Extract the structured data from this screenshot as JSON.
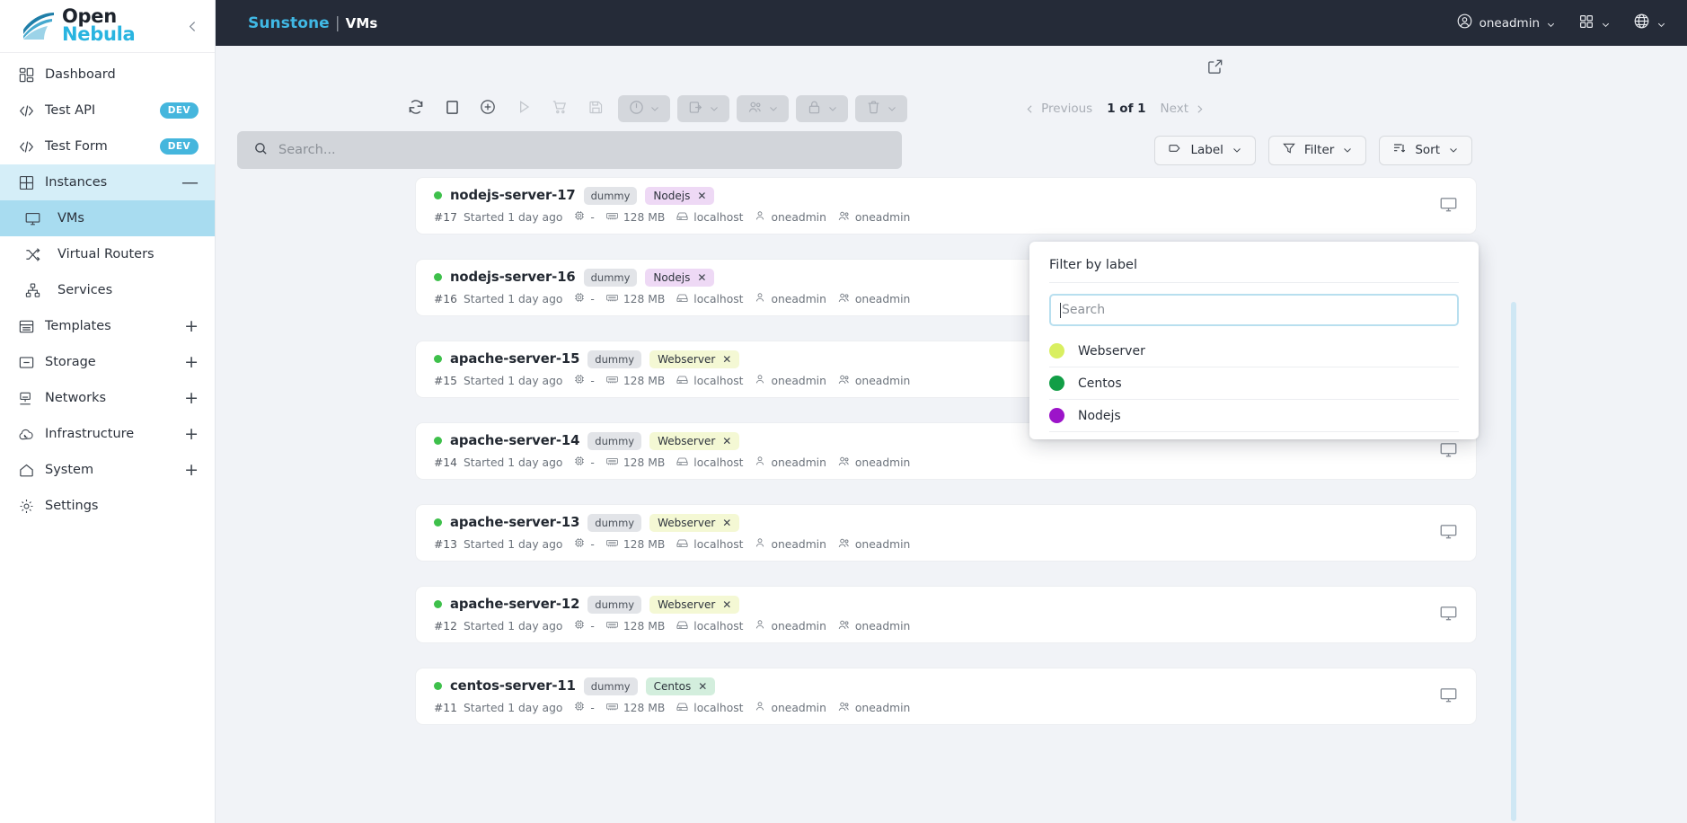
{
  "brand": {
    "line1": "Open",
    "line2": "Nebula",
    "collapse_icon": "chevron-left-icon"
  },
  "sidebar": {
    "items": [
      {
        "label": "Dashboard",
        "icon": "dashboard-icon",
        "badge": null,
        "suffix": null,
        "level": 0,
        "state": "normal"
      },
      {
        "label": "Test API",
        "icon": "code-icon",
        "badge": "DEV",
        "suffix": null,
        "level": 0,
        "state": "normal"
      },
      {
        "label": "Test Form",
        "icon": "code-icon",
        "badge": "DEV",
        "suffix": null,
        "level": 0,
        "state": "normal"
      },
      {
        "label": "Instances",
        "icon": "grid-icon",
        "badge": null,
        "suffix": "minus",
        "level": 0,
        "state": "active-parent"
      },
      {
        "label": "VMs",
        "icon": "monitor-icon",
        "badge": null,
        "suffix": null,
        "level": 1,
        "state": "active"
      },
      {
        "label": "Virtual Routers",
        "icon": "shuffle-icon",
        "badge": null,
        "suffix": null,
        "level": 1,
        "state": "normal"
      },
      {
        "label": "Services",
        "icon": "services-icon",
        "badge": null,
        "suffix": null,
        "level": 1,
        "state": "normal"
      },
      {
        "label": "Templates",
        "icon": "template-icon",
        "badge": null,
        "suffix": "plus",
        "level": 0,
        "state": "normal"
      },
      {
        "label": "Storage",
        "icon": "storage-icon",
        "badge": null,
        "suffix": "plus",
        "level": 0,
        "state": "normal"
      },
      {
        "label": "Networks",
        "icon": "network-icon",
        "badge": null,
        "suffix": "plus",
        "level": 0,
        "state": "normal"
      },
      {
        "label": "Infrastructure",
        "icon": "cloud-icon",
        "badge": null,
        "suffix": "plus",
        "level": 0,
        "state": "normal"
      },
      {
        "label": "System",
        "icon": "home-icon",
        "badge": null,
        "suffix": "plus",
        "level": 0,
        "state": "normal"
      },
      {
        "label": "Settings",
        "icon": "gear-icon",
        "badge": null,
        "suffix": null,
        "level": 0,
        "state": "normal"
      }
    ]
  },
  "topbar": {
    "app_name": "Sunstone",
    "separator": "|",
    "page_name": "VMs",
    "user": "oneadmin",
    "user_icon": "user-circle-icon",
    "apps_icon": "apps-grid-icon",
    "language_icon": "globe-icon"
  },
  "toolbar": {
    "expand_icon": "external-link-icon",
    "buttons": [
      {
        "name": "refresh",
        "icon": "refresh-icon",
        "dim": false
      },
      {
        "name": "select-all",
        "icon": "square-icon",
        "dim": false
      },
      {
        "name": "create",
        "icon": "plus-circle-icon",
        "dim": false
      },
      {
        "name": "play",
        "icon": "play-icon",
        "dim": true
      },
      {
        "name": "marketplace",
        "icon": "cart-icon",
        "dim": true
      },
      {
        "name": "save",
        "icon": "save-icon",
        "dim": true
      }
    ],
    "dropdowns": [
      {
        "name": "power",
        "icon": "power-icon"
      },
      {
        "name": "migrate",
        "icon": "migrate-icon"
      },
      {
        "name": "ownership",
        "icon": "users-icon"
      },
      {
        "name": "lock",
        "icon": "lock-icon"
      },
      {
        "name": "delete",
        "icon": "trash-icon"
      }
    ]
  },
  "pagination": {
    "previous": "Previous",
    "count": "1 of 1",
    "next": "Next"
  },
  "search": {
    "placeholder": "Search...",
    "icon": "search-icon",
    "value": ""
  },
  "filter_buttons": [
    {
      "label": "Label",
      "icon": "tag-icon",
      "name": "label-filter-button"
    },
    {
      "label": "Filter",
      "icon": "funnel-icon",
      "name": "filter-button"
    },
    {
      "label": "Sort",
      "icon": "sort-icon",
      "name": "sort-button"
    }
  ],
  "label_popup": {
    "title": "Filter by label",
    "search_placeholder": "Search",
    "search_value": "",
    "options": [
      {
        "label": "Webserver",
        "color": "#d9ef61"
      },
      {
        "label": "Centos",
        "color": "#129e46"
      },
      {
        "label": "Nodejs",
        "color": "#9c14c9"
      }
    ]
  },
  "label_chip_colors": {
    "Webserver": "#f4f8d4",
    "Centos": "#d3eedd",
    "Nodejs": "#eed9f5"
  },
  "vm_list": {
    "hypervisor_chip": "dummy",
    "monitor_icon": "monitor-icon",
    "items": [
      {
        "name": "nodejs-server-17",
        "id": "#17",
        "status": "Started 1 day ago",
        "cpu": "-",
        "memory": "128 MB",
        "host": "localhost",
        "owner": "oneadmin",
        "group": "oneadmin",
        "label": "Nodejs",
        "state_color": "#3ec04b"
      },
      {
        "name": "nodejs-server-16",
        "id": "#16",
        "status": "Started 1 day ago",
        "cpu": "-",
        "memory": "128 MB",
        "host": "localhost",
        "owner": "oneadmin",
        "group": "oneadmin",
        "label": "Nodejs",
        "state_color": "#3ec04b"
      },
      {
        "name": "apache-server-15",
        "id": "#15",
        "status": "Started 1 day ago",
        "cpu": "-",
        "memory": "128 MB",
        "host": "localhost",
        "owner": "oneadmin",
        "group": "oneadmin",
        "label": "Webserver",
        "state_color": "#3ec04b"
      },
      {
        "name": "apache-server-14",
        "id": "#14",
        "status": "Started 1 day ago",
        "cpu": "-",
        "memory": "128 MB",
        "host": "localhost",
        "owner": "oneadmin",
        "group": "oneadmin",
        "label": "Webserver",
        "state_color": "#3ec04b"
      },
      {
        "name": "apache-server-13",
        "id": "#13",
        "status": "Started 1 day ago",
        "cpu": "-",
        "memory": "128 MB",
        "host": "localhost",
        "owner": "oneadmin",
        "group": "oneadmin",
        "label": "Webserver",
        "state_color": "#3ec04b"
      },
      {
        "name": "apache-server-12",
        "id": "#12",
        "status": "Started 1 day ago",
        "cpu": "-",
        "memory": "128 MB",
        "host": "localhost",
        "owner": "oneadmin",
        "group": "oneadmin",
        "label": "Webserver",
        "state_color": "#3ec04b"
      },
      {
        "name": "centos-server-11",
        "id": "#11",
        "status": "Started 1 day ago",
        "cpu": "-",
        "memory": "128 MB",
        "host": "localhost",
        "owner": "oneadmin",
        "group": "oneadmin",
        "label": "Centos",
        "state_color": "#3ec04b"
      }
    ]
  },
  "colors": {
    "topbar_bg": "#252b38",
    "accent_cyan": "#40b8e4",
    "page_bg": "#f1f3f7",
    "active_nav": "#a8dcf0",
    "active_parent_nav": "#d5eef8",
    "dev_badge": "#45b6dd"
  }
}
